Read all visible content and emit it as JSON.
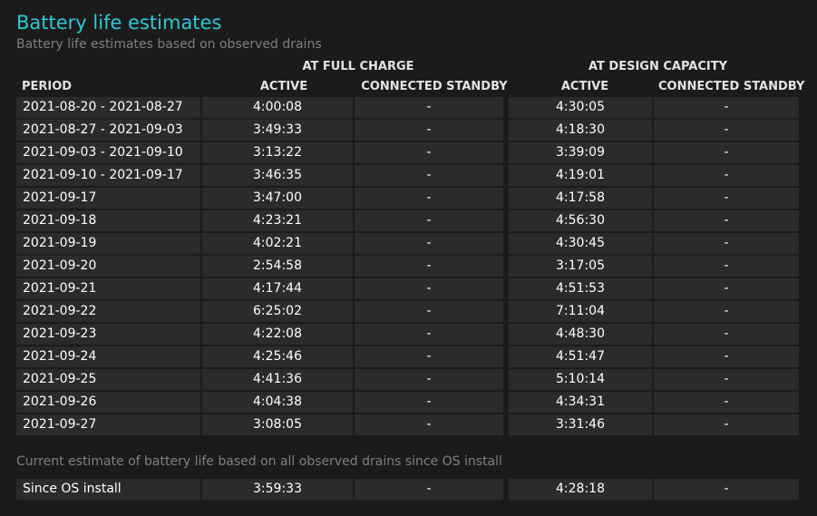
{
  "title": "Battery life estimates",
  "subtitle": "Battery life estimates based on observed drains",
  "group_headers": {
    "full_charge": "AT FULL CHARGE",
    "design_capacity": "AT DESIGN CAPACITY"
  },
  "column_headers": {
    "period": "PERIOD",
    "fc_active": "ACTIVE",
    "fc_standby": "CONNECTED STANDBY",
    "dc_active": "ACTIVE",
    "dc_standby": "CONNECTED STANDBY"
  },
  "rows": [
    {
      "period": "2021-08-20 - 2021-08-27",
      "fc_active": "4:00:08",
      "fc_standby": "-",
      "dc_active": "4:30:05",
      "dc_standby": "-"
    },
    {
      "period": "2021-08-27 - 2021-09-03",
      "fc_active": "3:49:33",
      "fc_standby": "-",
      "dc_active": "4:18:30",
      "dc_standby": "-"
    },
    {
      "period": "2021-09-03 - 2021-09-10",
      "fc_active": "3:13:22",
      "fc_standby": "-",
      "dc_active": "3:39:09",
      "dc_standby": "-"
    },
    {
      "period": "2021-09-10 - 2021-09-17",
      "fc_active": "3:46:35",
      "fc_standby": "-",
      "dc_active": "4:19:01",
      "dc_standby": "-"
    },
    {
      "period": "2021-09-17",
      "fc_active": "3:47:00",
      "fc_standby": "-",
      "dc_active": "4:17:58",
      "dc_standby": "-"
    },
    {
      "period": "2021-09-18",
      "fc_active": "4:23:21",
      "fc_standby": "-",
      "dc_active": "4:56:30",
      "dc_standby": "-"
    },
    {
      "period": "2021-09-19",
      "fc_active": "4:02:21",
      "fc_standby": "-",
      "dc_active": "4:30:45",
      "dc_standby": "-"
    },
    {
      "period": "2021-09-20",
      "fc_active": "2:54:58",
      "fc_standby": "-",
      "dc_active": "3:17:05",
      "dc_standby": "-"
    },
    {
      "period": "2021-09-21",
      "fc_active": "4:17:44",
      "fc_standby": "-",
      "dc_active": "4:51:53",
      "dc_standby": "-"
    },
    {
      "period": "2021-09-22",
      "fc_active": "6:25:02",
      "fc_standby": "-",
      "dc_active": "7:11:04",
      "dc_standby": "-"
    },
    {
      "period": "2021-09-23",
      "fc_active": "4:22:08",
      "fc_standby": "-",
      "dc_active": "4:48:30",
      "dc_standby": "-"
    },
    {
      "period": "2021-09-24",
      "fc_active": "4:25:46",
      "fc_standby": "-",
      "dc_active": "4:51:47",
      "dc_standby": "-"
    },
    {
      "period": "2021-09-25",
      "fc_active": "4:41:36",
      "fc_standby": "-",
      "dc_active": "5:10:14",
      "dc_standby": "-"
    },
    {
      "period": "2021-09-26",
      "fc_active": "4:04:38",
      "fc_standby": "-",
      "dc_active": "4:34:31",
      "dc_standby": "-"
    },
    {
      "period": "2021-09-27",
      "fc_active": "3:08:05",
      "fc_standby": "-",
      "dc_active": "3:31:46",
      "dc_standby": "-"
    }
  ],
  "current_estimate_note": "Current estimate of battery life based on all observed drains since OS install",
  "since_install": {
    "period": "Since OS install",
    "fc_active": "3:59:33",
    "fc_standby": "-",
    "dc_active": "4:28:18",
    "dc_standby": "-"
  },
  "colors": {
    "title": "#2ec8d8",
    "subtitle": "#7f7f7f",
    "background": "#1b1b1b",
    "cell_background": "#2b2b2b"
  }
}
